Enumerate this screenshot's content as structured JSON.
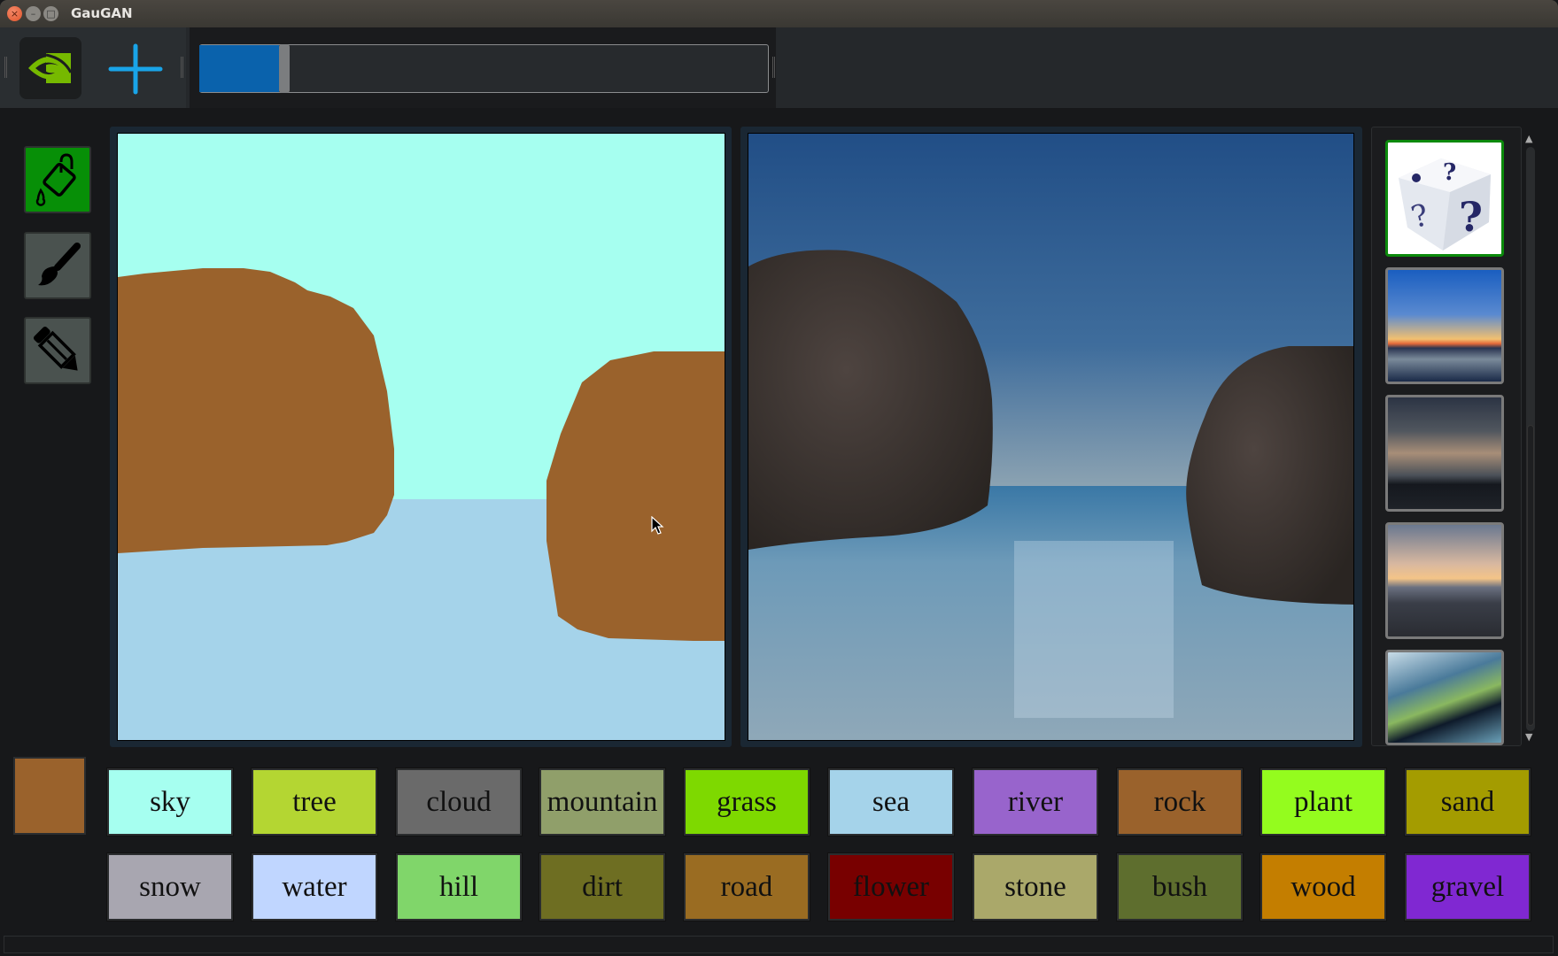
{
  "window": {
    "title": "GauGAN",
    "controls": [
      "close",
      "minimize",
      "maximize"
    ]
  },
  "toolbar": {
    "logo_icon": "nvidia-logo-icon",
    "add_icon": "plus-icon",
    "slider": {
      "value_fraction": 0.14,
      "fill_color": "#0a62ac"
    }
  },
  "tools": [
    {
      "name": "paint-bucket",
      "icon": "paint-bucket-icon",
      "active": true
    },
    {
      "name": "brush",
      "icon": "brush-icon",
      "active": false
    },
    {
      "name": "pencil",
      "icon": "pencil-icon",
      "active": false
    }
  ],
  "input_canvas": {
    "regions": [
      {
        "label": "sky",
        "color": "#a6fff0"
      },
      {
        "label": "sea",
        "color": "#a5d3ea"
      },
      {
        "label": "rock",
        "color": "#9a622c"
      }
    ]
  },
  "output_image": {
    "description": "generated seascape with two rocks"
  },
  "thumbnails": [
    {
      "name": "random-style",
      "icon": "dice-icon",
      "selected": true
    },
    {
      "name": "sunset-lake",
      "selected": false
    },
    {
      "name": "cloudy-dusk",
      "selected": false
    },
    {
      "name": "city-sunset",
      "selected": false
    },
    {
      "name": "painting",
      "selected": false
    }
  ],
  "current_color": "#9a622c",
  "labels_row1": [
    {
      "label": "sky",
      "color": "#a6fff0"
    },
    {
      "label": "tree",
      "color": "#b4d632"
    },
    {
      "label": "cloud",
      "color": "#6a6a6a"
    },
    {
      "label": "mountain",
      "color": "#909f6a"
    },
    {
      "label": "grass",
      "color": "#7ed900"
    },
    {
      "label": "sea",
      "color": "#a5d3ea"
    },
    {
      "label": "river",
      "color": "#9864cc"
    },
    {
      "label": "rock",
      "color": "#9a622c"
    },
    {
      "label": "plant",
      "color": "#94fc1e"
    },
    {
      "label": "sand",
      "color": "#a49c00"
    }
  ],
  "labels_row2": [
    {
      "label": "snow",
      "color": "#a8a6b0"
    },
    {
      "label": "water",
      "color": "#c0d6ff"
    },
    {
      "label": "hill",
      "color": "#80d66a"
    },
    {
      "label": "dirt",
      "color": "#6e6e22"
    },
    {
      "label": "road",
      "color": "#9a6c22"
    },
    {
      "label": "flower",
      "color": "#780000"
    },
    {
      "label": "stone",
      "color": "#aaa86a"
    },
    {
      "label": "bush",
      "color": "#5e6e2e"
    },
    {
      "label": "wood",
      "color": "#c47e00"
    },
    {
      "label": "gravel",
      "color": "#8028d2"
    }
  ]
}
